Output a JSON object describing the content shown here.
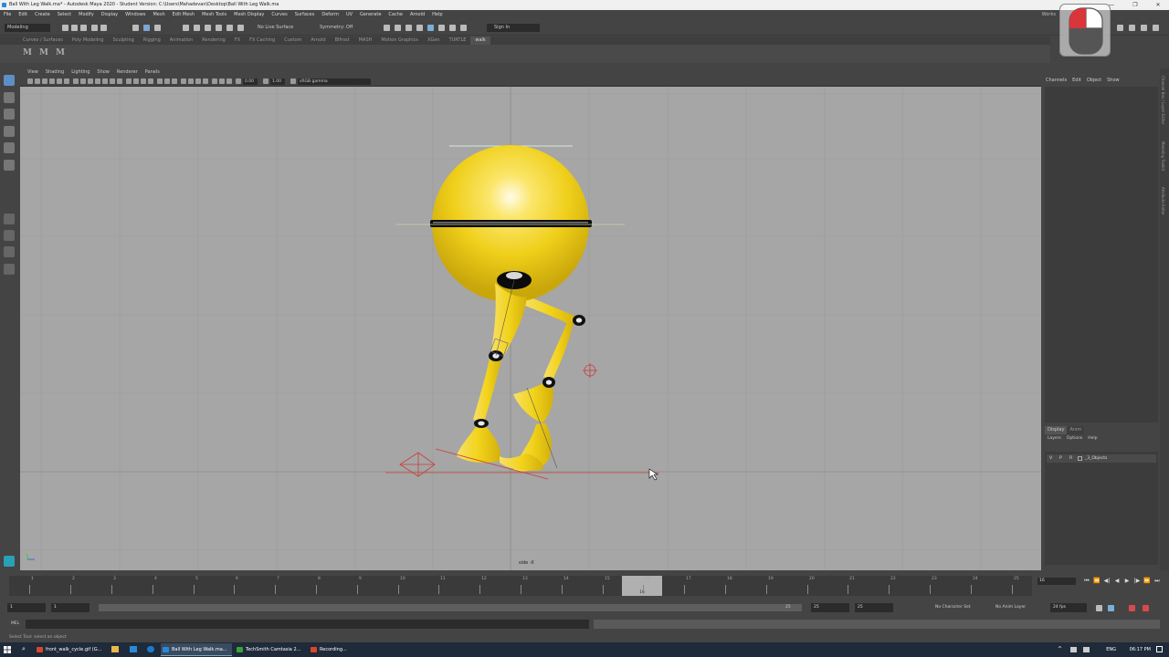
{
  "window": {
    "title": "Ball With Leg Walk.ma* - Autodesk Maya 2020 - Student Version: C:\\Users\\Mahadevan\\Desktop\\Ball With Leg Walk.ma",
    "minimize": "—",
    "restore": "❐",
    "close": "✕"
  },
  "menubar": {
    "items": [
      "File",
      "Edit",
      "Create",
      "Select",
      "Modify",
      "Display",
      "Windows",
      "Mesh",
      "Edit Mesh",
      "Mesh Tools",
      "Mesh Display",
      "Curves",
      "Surfaces",
      "Deform",
      "UV",
      "Generate",
      "Cache",
      "Arnold",
      "Help"
    ],
    "workspace_label": "Works"
  },
  "statusline": {
    "mode": "Modeling",
    "live_surface": "No Live Surface",
    "symmetry": "Symmetry: Off",
    "signin": "Sign In"
  },
  "shelf": {
    "tabs": [
      "Curves / Surfaces",
      "Poly Modeling",
      "Sculpting",
      "Rigging",
      "Animation",
      "Rendering",
      "FX",
      "FX Caching",
      "Custom",
      "Arnold",
      "Bifrost",
      "MASH",
      "Motion Graphics",
      "XGen",
      "TURTLE",
      "walk"
    ],
    "active_tab": "walk",
    "buttons": [
      "M",
      "M",
      "M"
    ]
  },
  "panel": {
    "menu": [
      "View",
      "Shading",
      "Lighting",
      "Show",
      "Renderer",
      "Panels"
    ],
    "exposure": "0.00",
    "gamma": "1.00",
    "colorspace": "sRGB gamma",
    "camera_label": "side -X"
  },
  "channelbox": {
    "menu": [
      "Channels",
      "Edit",
      "Object",
      "Show"
    ],
    "side_tabs": [
      "Channel Box / Layer Editor",
      "Modeling Toolkit",
      "Attribute Editor"
    ],
    "layer_tabs": [
      "Display",
      "Anim"
    ],
    "layer_menu": [
      "Layers",
      "Options",
      "Help"
    ],
    "layer_row": {
      "v": "V",
      "p": "P",
      "r": "R",
      "name": "_3_Objects"
    }
  },
  "timeslider": {
    "ticks": [
      "1",
      "2",
      "3",
      "4",
      "5",
      "6",
      "7",
      "8",
      "9",
      "10",
      "11",
      "12",
      "13",
      "14",
      "15",
      "16",
      "17",
      "18",
      "19",
      "20",
      "21",
      "22",
      "23",
      "24",
      "25"
    ],
    "current_frame": "16",
    "current_frame_field": "16"
  },
  "rangeslider": {
    "start": "1",
    "start_inner": "1",
    "end_inner": "25",
    "end": "25",
    "end_outer": "25",
    "character_set": "No Character Set",
    "anim_layer": "No Anim Layer",
    "fps": "24 fps"
  },
  "cmdline": {
    "label": "MEL",
    "help": "Select Tool: select an object"
  },
  "taskbar": {
    "items": [
      {
        "label": "front_walk_cycle.gif (G...",
        "color": "#d9472b"
      },
      {
        "label": "Ball With Leg Walk.ma...",
        "color": "#2a8ad8"
      },
      {
        "label": "TechSmith Camtasia 2...",
        "color": "#3aa23a"
      },
      {
        "label": "Recording...",
        "color": "#d9472b"
      }
    ],
    "lang": "ENG",
    "time": "06:17 PM"
  },
  "colors": {
    "body": "#f2d31a",
    "body_highlight": "#fff6c0",
    "joint": "#111111",
    "viewport": "#a6a6a6",
    "ground": "#c8503c"
  }
}
